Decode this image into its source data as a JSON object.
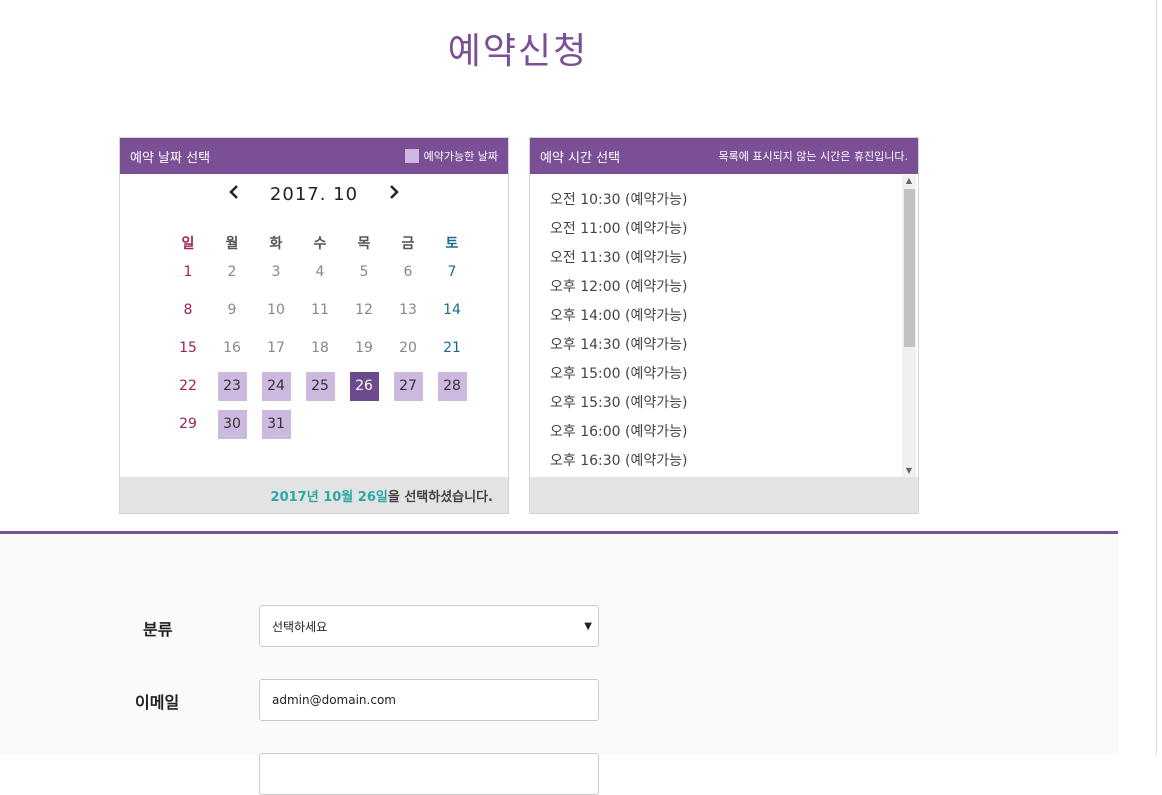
{
  "page": {
    "title": "예약신청"
  },
  "calendar": {
    "header_title": "예약 날짜 선택",
    "legend_label": "예약가능한 날짜",
    "month_label": "2017.  10",
    "prev_icon": "chevron-left-icon",
    "next_icon": "chevron-right-icon",
    "weekdays": [
      "일",
      "월",
      "화",
      "수",
      "목",
      "금",
      "토"
    ],
    "weeks": [
      [
        {
          "d": "1"
        },
        {
          "d": "2"
        },
        {
          "d": "3"
        },
        {
          "d": "4"
        },
        {
          "d": "5"
        },
        {
          "d": "6"
        },
        {
          "d": "7"
        }
      ],
      [
        {
          "d": "8"
        },
        {
          "d": "9"
        },
        {
          "d": "10"
        },
        {
          "d": "11"
        },
        {
          "d": "12"
        },
        {
          "d": "13"
        },
        {
          "d": "14"
        }
      ],
      [
        {
          "d": "15"
        },
        {
          "d": "16"
        },
        {
          "d": "17"
        },
        {
          "d": "18"
        },
        {
          "d": "19"
        },
        {
          "d": "20"
        },
        {
          "d": "21"
        }
      ],
      [
        {
          "d": "22"
        },
        {
          "d": "23",
          "state": "avail"
        },
        {
          "d": "24",
          "state": "avail"
        },
        {
          "d": "25",
          "state": "avail"
        },
        {
          "d": "26",
          "state": "selected"
        },
        {
          "d": "27",
          "state": "avail"
        },
        {
          "d": "28",
          "state": "avail"
        }
      ],
      [
        {
          "d": "29"
        },
        {
          "d": "30",
          "state": "avail"
        },
        {
          "d": "31",
          "state": "avail"
        }
      ]
    ],
    "footer_highlight": "2017년 10월 26일",
    "footer_suffix": "을 선택하셨습니다.",
    "colors": {
      "available": "#cdb8df",
      "selected": "#6b4b8e",
      "sunday": "#a32055",
      "saturday": "#1b6c8c"
    }
  },
  "time_panel": {
    "header_title": "예약 시간 선택",
    "header_note": "목록에 표시되지 않는 시간은 휴진입니다.",
    "items": [
      "오전 10:30 (예약가능)",
      "오전 11:00 (예약가능)",
      "오전 11:30 (예약가능)",
      "오후 12:00 (예약가능)",
      "오후 14:00 (예약가능)",
      "오후 14:30 (예약가능)",
      "오후 15:00 (예약가능)",
      "오후 15:30 (예약가능)",
      "오후 16:00 (예약가능)",
      "오후 16:30 (예약가능)"
    ]
  },
  "form": {
    "category_label": "분류",
    "category_value": "선택하세요",
    "email_label": "이메일",
    "email_value": "admin@domain.com"
  },
  "theme": {
    "accent": "#7a4f96",
    "highlight": "#2aa9a4"
  }
}
